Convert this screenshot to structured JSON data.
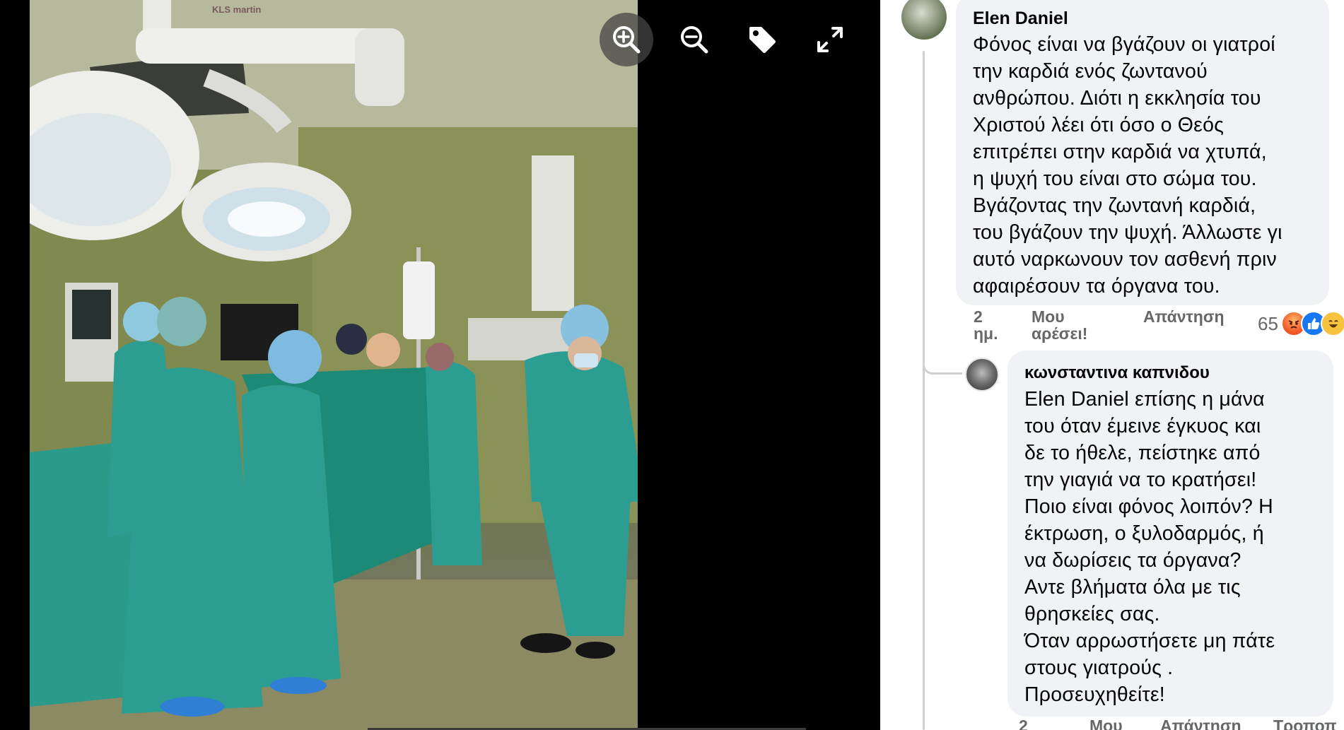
{
  "viewer": {
    "photo_brand_text": "KLS martin",
    "toolbar": [
      {
        "name": "zoom-in-icon"
      },
      {
        "name": "zoom-out-icon"
      },
      {
        "name": "tag-icon"
      },
      {
        "name": "fullscreen-icon"
      }
    ]
  },
  "comments": [
    {
      "author": "Elen Daniel",
      "text": "Φόνος είναι να βγάζουν οι γιατροί\nτην καρδιά ενός ζωντανού\nανθρώπου. Διότι η εκκλησία του\nΧριστού λέει ότι όσο ο Θεός\nεπιτρέπει στην καρδιά να χτυπά,\nη ψυχή του είναι στο σώμα του.\nΒγάζοντας την ζωντανή καρδιά,\nτου βγάζουν την ψυχή. Άλλωστε γι\nαυτό ναρκωνουν τον ασθενή πριν\nαφαιρέσουν τα όργανα του.",
      "time": "2\nημ.",
      "like_label": "Μου\nαρέσει!",
      "reply_label": "Απάντηση",
      "reaction_count": "65"
    },
    {
      "author": "κωνσταντινα καπνιδου",
      "text": "Elen Daniel επίσης η μάνα\nτου όταν έμεινε έγκυος και\nδε το ήθελε, πείστηκε από\nτην γιαγιά να το κρατήσει!\nΠοιο είναι φόνος λοιπόν? Η\nέκτρωση, ο ξυλοδαρμός, ή\nνα δωρίσεις τα όργανα?\nΑντε βλήματα όλα με τις\nθρησκείες σας.\nΌταν αρρωστήσετε μη πάτε\nστους γιατρούς .\nΠροσευχηθείτε!",
      "time": "2",
      "like_label": "Μου",
      "reply_label": "Απάντηση",
      "edit_label": "Τροποπ"
    }
  ]
}
